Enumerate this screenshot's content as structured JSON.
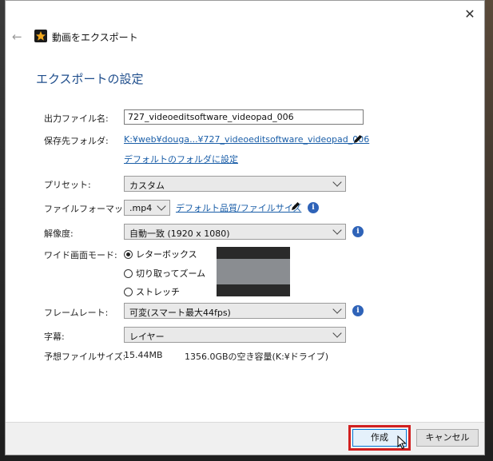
{
  "window": {
    "title": "動画をエクスポート",
    "close_glyph": "✕",
    "back_glyph": "←"
  },
  "section_title": "エクスポートの設定",
  "fields": {
    "output_filename": {
      "label": "出力ファイル名:",
      "value": "727_videoeditsoftware_videopad_006"
    },
    "save_folder": {
      "label": "保存先フォルダ:",
      "path": "K:¥web¥douga...¥727_videoeditsoftware_videopad_006",
      "set_default_link": "デフォルトのフォルダに設定"
    },
    "preset": {
      "label": "プリセット:",
      "value": "カスタム"
    },
    "file_format": {
      "label": "ファイルフォーマット:",
      "value": ".mp4",
      "quality_link": "デフォルト品質/ファイルサイズ"
    },
    "resolution": {
      "label": "解像度:",
      "value": "自動一致 (1920 x 1080)"
    },
    "widescreen_mode": {
      "label": "ワイド画面モード:",
      "options": [
        "レターボックス",
        "切り取ってズーム",
        "ストレッチ"
      ],
      "selected": "レターボックス"
    },
    "frame_rate": {
      "label": "フレームレート:",
      "value": "可変(スマート最大44fps)"
    },
    "subtitles": {
      "label": "字幕:",
      "value": "レイヤー"
    },
    "estimated_size": {
      "label": "予想ファイルサイズ:",
      "size": "15.44MB",
      "free_space": "1356.0GBの空き容量(K:¥ドライブ)"
    }
  },
  "footer": {
    "create_label": "作成",
    "cancel_label": "キャンセル"
  },
  "colors": {
    "accent": "#1f4e8c",
    "link": "#1a5ea8",
    "info": "#2f63b8",
    "highlight": "#d12020"
  },
  "icons": [
    "close-icon",
    "back-arrow-icon",
    "app-icon",
    "pencil-icon",
    "info-icon",
    "chevron-down-icon",
    "mouse-cursor-icon"
  ]
}
